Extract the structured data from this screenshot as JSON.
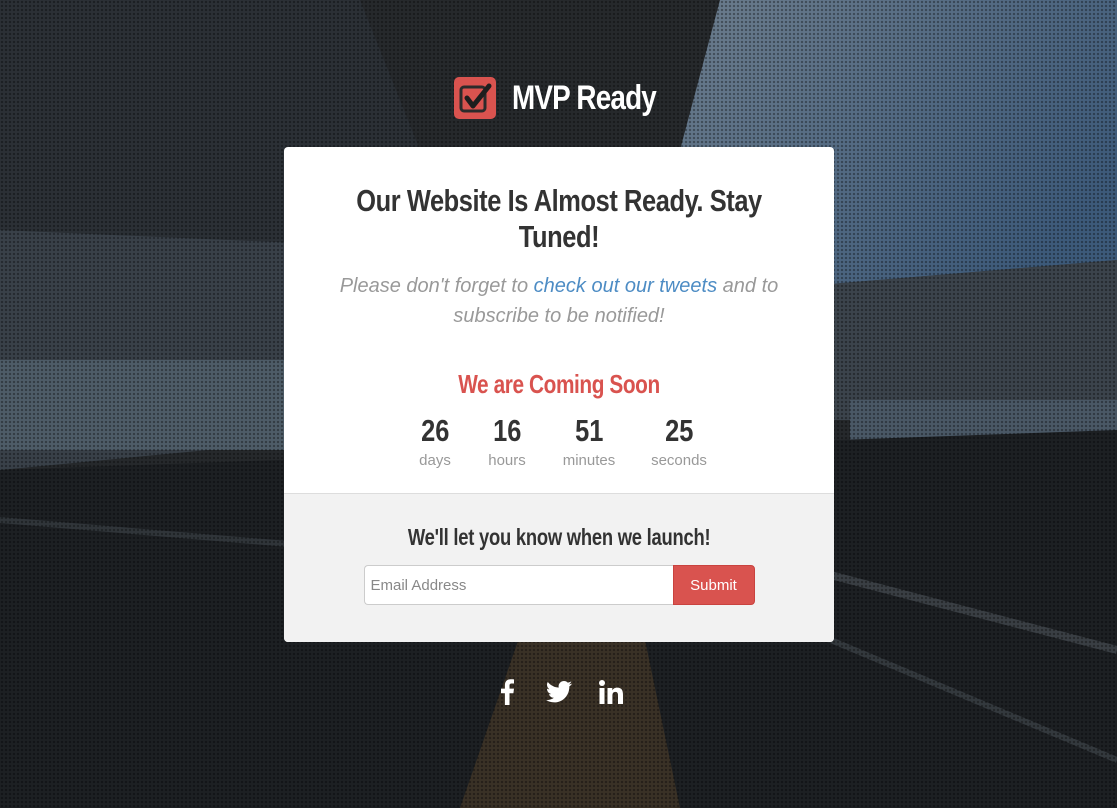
{
  "brand": {
    "name": "MVP Ready",
    "accent": "#d9534f",
    "logo_icon": "check-square-icon"
  },
  "hero": {
    "title": "Our Website Is Almost Ready. Stay Tuned!",
    "lead_before": "Please don't forget to ",
    "lead_link": "check out our tweets",
    "lead_after": " and to subscribe to be notified!"
  },
  "countdown": {
    "heading": "We are Coming Soon",
    "units": [
      {
        "value": "26",
        "label": "days"
      },
      {
        "value": "16",
        "label": "hours"
      },
      {
        "value": "51",
        "label": "minutes"
      },
      {
        "value": "25",
        "label": "seconds"
      }
    ]
  },
  "signup": {
    "heading": "We'll let you know when we launch!",
    "email_placeholder": "Email Address",
    "submit_label": "Submit"
  },
  "social": [
    {
      "name": "facebook-icon"
    },
    {
      "name": "twitter-icon"
    },
    {
      "name": "linkedin-icon"
    }
  ]
}
